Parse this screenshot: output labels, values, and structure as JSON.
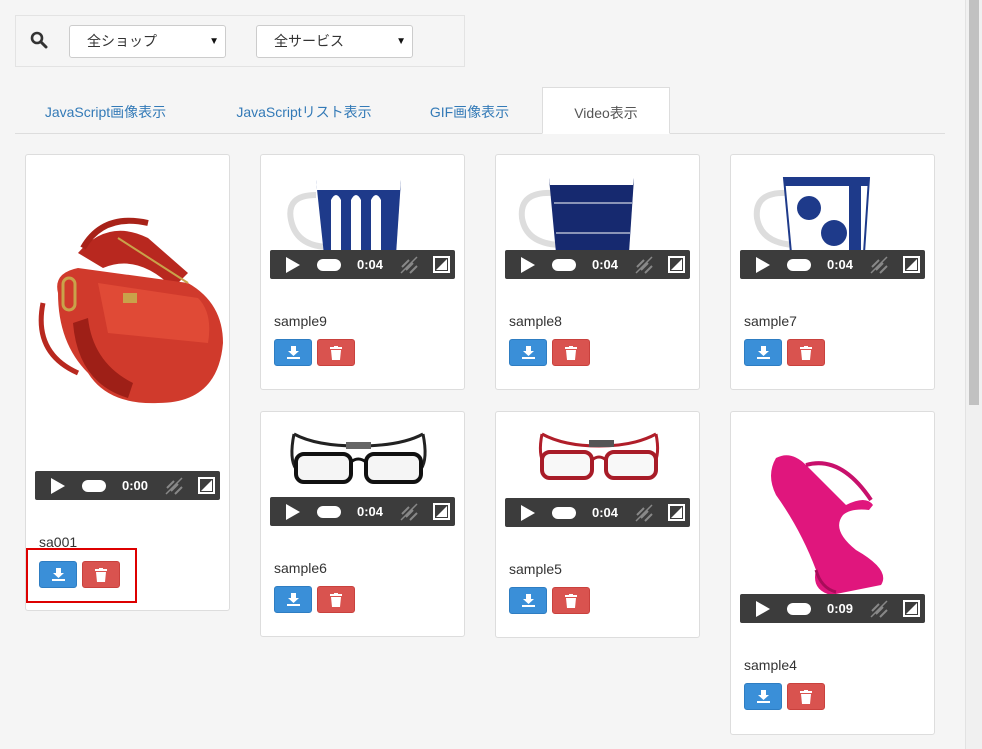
{
  "filters": {
    "shop_select": "全ショップ",
    "service_select": "全サービス"
  },
  "tabs": [
    {
      "label": "JavaScript画像表示",
      "active": false
    },
    {
      "label": "JavaScriptリスト表示",
      "active": false
    },
    {
      "label": "GIF画像表示",
      "active": false
    },
    {
      "label": "Video表示",
      "active": true
    }
  ],
  "items": [
    {
      "name": "sa001",
      "time": "0:00",
      "image": "red-handbag"
    },
    {
      "name": "sample9",
      "time": "0:04",
      "image": "blue-mug"
    },
    {
      "name": "sample8",
      "time": "0:04",
      "image": "navy-mug"
    },
    {
      "name": "sample7",
      "time": "0:04",
      "image": "dotted-mug"
    },
    {
      "name": "sample6",
      "time": "0:04",
      "image": "black-glasses"
    },
    {
      "name": "sample5",
      "time": "0:04",
      "image": "red-glasses"
    },
    {
      "name": "sample4",
      "time": "0:09",
      "image": "pink-heel"
    }
  ],
  "colors": {
    "link": "#337ab7",
    "download_button": "#3a8fd8",
    "delete_button": "#d9534f",
    "player_bar": "#3c3c3c",
    "highlight": "#dd0000"
  }
}
